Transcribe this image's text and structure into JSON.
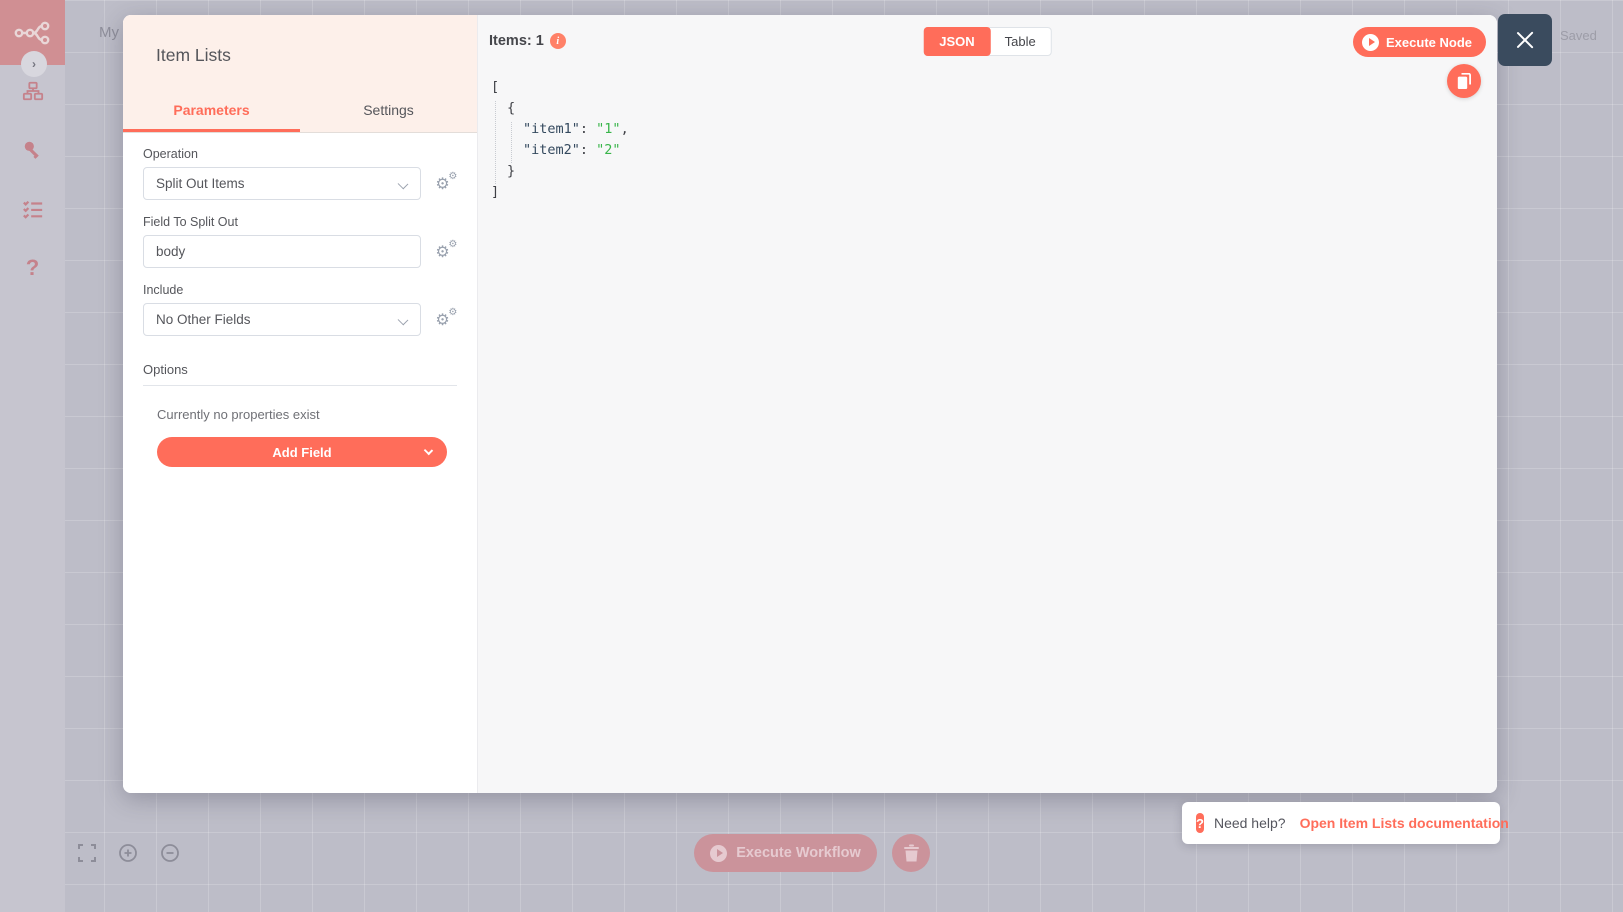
{
  "canvas": {
    "workflow_title_partial": "My",
    "saved_status": "Saved"
  },
  "sidebar": {
    "icons": [
      "n8n-logo",
      "collapse-chevron",
      "workflows",
      "credentials",
      "executions",
      "help"
    ]
  },
  "modal": {
    "title": "Item Lists",
    "tabs": [
      {
        "label": "Parameters",
        "active": true
      },
      {
        "label": "Settings",
        "active": false
      }
    ],
    "fields": {
      "operation": {
        "label": "Operation",
        "value": "Split Out Items",
        "type": "select"
      },
      "field_to_split_out": {
        "label": "Field To Split Out",
        "value": "body",
        "type": "text"
      },
      "include": {
        "label": "Include",
        "value": "No Other Fields",
        "type": "select"
      }
    },
    "options": {
      "label": "Options",
      "empty_text": "Currently no properties exist",
      "add_field_label": "Add Field"
    }
  },
  "output_panel": {
    "items_label": "Items: 1",
    "info_icon": "i",
    "view_toggle": [
      {
        "label": "JSON",
        "active": true
      },
      {
        "label": "Table",
        "active": false
      }
    ],
    "execute_node_label": "Execute Node",
    "json_view": {
      "lines": [
        {
          "indent": 0,
          "tokens": [
            {
              "t": "punct",
              "v": "["
            }
          ]
        },
        {
          "indent": 1,
          "tokens": [
            {
              "t": "punct",
              "v": "{"
            }
          ]
        },
        {
          "indent": 2,
          "tokens": [
            {
              "t": "key",
              "v": "\"item1\""
            },
            {
              "t": "punct",
              "v": ": "
            },
            {
              "t": "str",
              "v": "\"1\""
            },
            {
              "t": "punct",
              "v": ","
            }
          ]
        },
        {
          "indent": 2,
          "tokens": [
            {
              "t": "key",
              "v": "\"item2\""
            },
            {
              "t": "punct",
              "v": ": "
            },
            {
              "t": "str",
              "v": "\"2\""
            }
          ]
        },
        {
          "indent": 1,
          "tokens": [
            {
              "t": "punct",
              "v": "}"
            }
          ]
        },
        {
          "indent": 0,
          "tokens": [
            {
              "t": "punct",
              "v": "]"
            }
          ]
        }
      ]
    }
  },
  "canvas_controls": {
    "execute_workflow_label": "Execute Workflow"
  },
  "help_banner": {
    "icon": "?",
    "prefix": "Need help?",
    "link_label": "Open Item Lists documentation"
  },
  "colors": {
    "primary": "#ff6d5a",
    "header_bg": "#fdf0ea",
    "close_button_bg": "#3a4b5e",
    "json_key": "#34495e",
    "json_string": "#39b54a",
    "overlay_bg": "#bdbdc8"
  }
}
